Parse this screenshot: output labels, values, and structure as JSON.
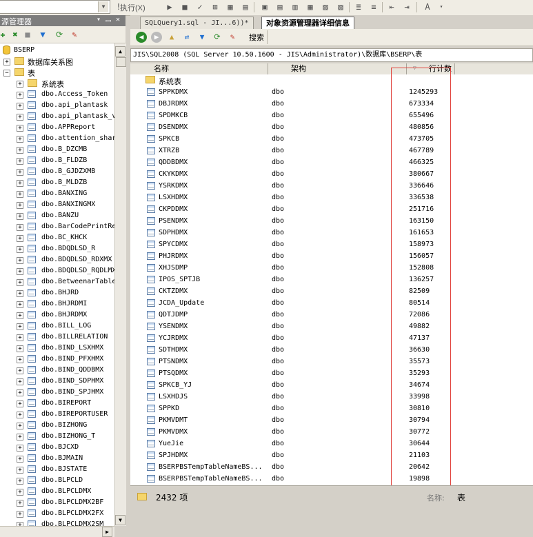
{
  "toolbar": {
    "execute_label": "执行(X)"
  },
  "object_explorer": {
    "title": "源管理器",
    "pin_icon": "pin-icon",
    "close_icon": "close-icon",
    "tree": {
      "database": "BSERP",
      "diagrams_folder": "数据库关系图",
      "tables_folder": "表",
      "system_tables_folder": "系统表",
      "tables": [
        "dbo.Access_Token",
        "dbo.api_plantask",
        "dbo.api_plantask_v",
        "dbo.APPReport",
        "dbo.attention_shar",
        "dbo.B_DZCMB",
        "dbo.B_FLDZB",
        "dbo.B_GJDZXMB",
        "dbo.B_MLDZB",
        "dbo.BANXING",
        "dbo.BANXINGMX",
        "dbo.BANZU",
        "dbo.BarCodePrintRe",
        "dbo.BC_KHCK",
        "dbo.BDQDLSD_R",
        "dbo.BDQDLSD_RDXMX",
        "dbo.BDQDLSD_RQDLMX",
        "dbo.BetweenarTable",
        "dbo.BHJRD",
        "dbo.BHJRDMI",
        "dbo.BHJRDMX",
        "dbo.BILL_LOG",
        "dbo.BILLRELATION",
        "dbo.BIND_LSXHMX",
        "dbo.BIND_PFXHMX",
        "dbo.BIND_QDDBMX",
        "dbo.BIND_SDPHMX",
        "dbo.BIND_SPJHMX",
        "dbo.BIREPORT",
        "dbo.BIREPORTUSER",
        "dbo.BIZHONG",
        "dbo.BIZHONG_T",
        "dbo.BJCXD",
        "dbo.BJMAIN",
        "dbo.BJSTATE",
        "dbo.BLPCLD",
        "dbo.BLPCLDMX",
        "dbo.BLPCLDMX2BF",
        "dbo.BLPCLDMX2FX",
        "dbo.BLPCLDMX2SM"
      ]
    }
  },
  "tabs": [
    {
      "label": "SQLQuery1.sql - JI...6))*"
    },
    {
      "label": "对象资源管理器详细信息"
    }
  ],
  "details": {
    "search_label": "搜索",
    "breadcrumb": "JIS\\SQL2008 (SQL Server 10.50.1600 - JIS\\Administrator)\\数据库\\BSERP\\表",
    "columns": {
      "name": "名称",
      "schema": "架构",
      "row_count": "行计数"
    },
    "system_tables_folder": "系统表",
    "rows": [
      {
        "name": "SPPKDMX",
        "schema": "dbo",
        "count": "1245293"
      },
      {
        "name": "DBJRDMX",
        "schema": "dbo",
        "count": "673334"
      },
      {
        "name": "SPDMKCB",
        "schema": "dbo",
        "count": "655496"
      },
      {
        "name": "DSENDMX",
        "schema": "dbo",
        "count": "480856"
      },
      {
        "name": "SPKCB",
        "schema": "dbo",
        "count": "473705"
      },
      {
        "name": "XTRZB",
        "schema": "dbo",
        "count": "467789"
      },
      {
        "name": "QDDBDMX",
        "schema": "dbo",
        "count": "466325"
      },
      {
        "name": "CKYKDMX",
        "schema": "dbo",
        "count": "380667"
      },
      {
        "name": "YSRKDMX",
        "schema": "dbo",
        "count": "336646"
      },
      {
        "name": "LSXHDMX",
        "schema": "dbo",
        "count": "336538"
      },
      {
        "name": "CKPDDMX",
        "schema": "dbo",
        "count": "251716"
      },
      {
        "name": "PSENDMX",
        "schema": "dbo",
        "count": "163150"
      },
      {
        "name": "SDPHDMX",
        "schema": "dbo",
        "count": "161653"
      },
      {
        "name": "SPYCDMX",
        "schema": "dbo",
        "count": "158973"
      },
      {
        "name": "PHJRDMX",
        "schema": "dbo",
        "count": "156057"
      },
      {
        "name": "XHJSDMP",
        "schema": "dbo",
        "count": "152808"
      },
      {
        "name": "IPOS_SPTJB",
        "schema": "dbo",
        "count": "136257"
      },
      {
        "name": "CKTZDMX",
        "schema": "dbo",
        "count": "82509"
      },
      {
        "name": "JCDA_Update",
        "schema": "dbo",
        "count": "80514"
      },
      {
        "name": "QDTJDMP",
        "schema": "dbo",
        "count": "72086"
      },
      {
        "name": "YSENDMX",
        "schema": "dbo",
        "count": "49882"
      },
      {
        "name": "YCJRDMX",
        "schema": "dbo",
        "count": "47137"
      },
      {
        "name": "SDTHDMX",
        "schema": "dbo",
        "count": "36630"
      },
      {
        "name": "PTSNDMX",
        "schema": "dbo",
        "count": "35573"
      },
      {
        "name": "PTSQDMX",
        "schema": "dbo",
        "count": "35293"
      },
      {
        "name": "SPKCB_YJ",
        "schema": "dbo",
        "count": "34674"
      },
      {
        "name": "LSXHDJS",
        "schema": "dbo",
        "count": "33998"
      },
      {
        "name": "SPPKD",
        "schema": "dbo",
        "count": "30810"
      },
      {
        "name": "PKMVDMT",
        "schema": "dbo",
        "count": "30794"
      },
      {
        "name": "PKMVDMX",
        "schema": "dbo",
        "count": "30772"
      },
      {
        "name": "YueJie",
        "schema": "dbo",
        "count": "30644"
      },
      {
        "name": "SPJHDMX",
        "schema": "dbo",
        "count": "21103"
      },
      {
        "name": "BSERPBSTempTableNameBS...",
        "schema": "dbo",
        "count": "20642"
      },
      {
        "name": "BSERPBSTempTableNameBS...",
        "schema": "dbo",
        "count": "19898"
      }
    ],
    "status": {
      "count_text": "2432 项",
      "name_label": "名称:",
      "name_value": "表"
    }
  },
  "colors": {
    "highlight_box": "#e0403a",
    "panel_header": "#7d7d7d",
    "window_bg": "#d4d0c8"
  }
}
